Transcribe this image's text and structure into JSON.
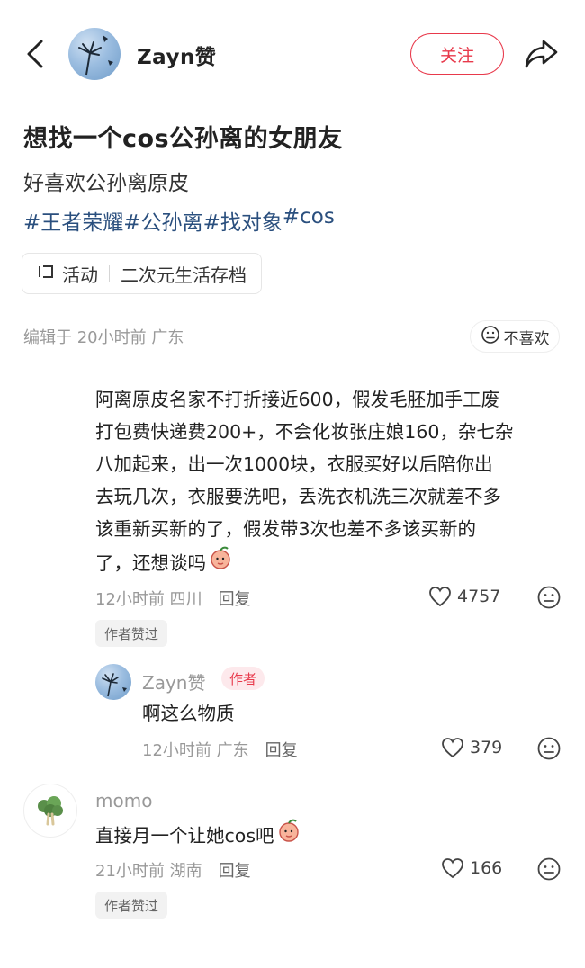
{
  "header": {
    "author_name": "Zayn赞",
    "follow_label": "关注"
  },
  "post": {
    "title": "想找一个cos公孙离的女朋友",
    "body": "好喜欢公孙离原皮",
    "tags": [
      "#王者荣耀",
      "#公孙离",
      "#找对象",
      "#cos"
    ],
    "topic_activity": "活动",
    "topic_name": "二次元生活存档",
    "meta": "编辑于 20小时前 广东",
    "dislike_label": "不喜欢"
  },
  "comments": [
    {
      "lines": [
        "阿离原皮名家不打折接近600，假发毛胚加手工废",
        "打包费快递费200+，不会化妆张庄娘160，杂七杂",
        "八加起来，出一次1000块，衣服买好以后陪你出",
        "去玩几次，衣服要洗吧，丢洗衣机洗三次就差不多",
        "该重新买新的了，假发带3次也差不多该买新的",
        "了，还想谈吗"
      ],
      "time_location": "12小时前 四川",
      "reply_label": "回复",
      "likes": "4757",
      "badge": "作者赞过",
      "reply": {
        "name": "Zayn赞",
        "author_tag": "作者",
        "text": "啊这么物质",
        "time_location": "12小时前 广东",
        "reply_label": "回复",
        "likes": "379"
      }
    },
    {
      "username": "momo",
      "text": "直接月一个让她cos吧",
      "time_location": "21小时前 湖南",
      "reply_label": "回复",
      "likes": "166",
      "badge": "作者赞过"
    }
  ],
  "colors": {
    "accent": "#e8394b",
    "tag_link": "#2a4f7e",
    "muted": "#999999"
  }
}
